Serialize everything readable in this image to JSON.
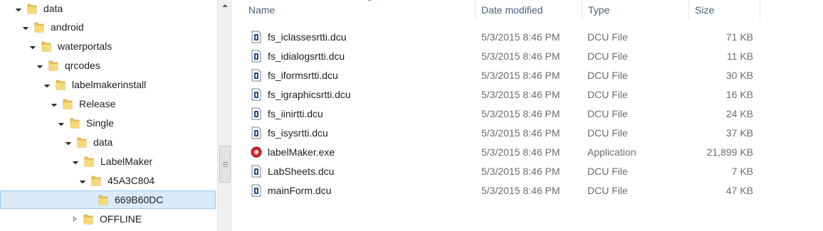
{
  "tree": {
    "items": [
      {
        "label": "data",
        "state": "expanded"
      },
      {
        "label": "android",
        "state": "expanded"
      },
      {
        "label": "waterportals",
        "state": "expanded"
      },
      {
        "label": "qrcodes",
        "state": "expanded"
      },
      {
        "label": "labelmakerinstall",
        "state": "expanded"
      },
      {
        "label": "Release",
        "state": "expanded"
      },
      {
        "label": "Single",
        "state": "expanded"
      },
      {
        "label": "data",
        "state": "expanded"
      },
      {
        "label": "LabelMaker",
        "state": "expanded"
      },
      {
        "label": "45A3C804",
        "state": "expanded"
      },
      {
        "label": "669B60DC",
        "state": "none",
        "selected": true
      },
      {
        "label": "OFFLINE",
        "state": "collapsed"
      }
    ]
  },
  "columns": {
    "name": "Name",
    "date": "Date modified",
    "type": "Type",
    "size": "Size"
  },
  "files": [
    {
      "name": "fs_iclassesrtti.dcu",
      "date": "5/3/2015 8:46 PM",
      "type": "DCU File",
      "size": "71 KB",
      "icon": "dcu-file-icon"
    },
    {
      "name": "fs_idialogsrtti.dcu",
      "date": "5/3/2015 8:46 PM",
      "type": "DCU File",
      "size": "11 KB",
      "icon": "dcu-file-icon"
    },
    {
      "name": "fs_iformsrtti.dcu",
      "date": "5/3/2015 8:46 PM",
      "type": "DCU File",
      "size": "30 KB",
      "icon": "dcu-file-icon"
    },
    {
      "name": "fs_igraphicsrtti.dcu",
      "date": "5/3/2015 8:46 PM",
      "type": "DCU File",
      "size": "16 KB",
      "icon": "dcu-file-icon"
    },
    {
      "name": "fs_iinirtti.dcu",
      "date": "5/3/2015 8:46 PM",
      "type": "DCU File",
      "size": "24 KB",
      "icon": "dcu-file-icon"
    },
    {
      "name": "fs_isysrtti.dcu",
      "date": "5/3/2015 8:46 PM",
      "type": "DCU File",
      "size": "37 KB",
      "icon": "dcu-file-icon"
    },
    {
      "name": "labelMaker.exe",
      "date": "5/3/2015 8:46 PM",
      "type": "Application",
      "size": "21,899 KB",
      "icon": "app-exe-icon"
    },
    {
      "name": "LabSheets.dcu",
      "date": "5/3/2015 8:46 PM",
      "type": "DCU File",
      "size": "7 KB",
      "icon": "dcu-file-icon"
    },
    {
      "name": "mainForm.dcu",
      "date": "5/3/2015 8:46 PM",
      "type": "DCU File",
      "size": "47 KB",
      "icon": "dcu-file-icon"
    }
  ],
  "colors": {
    "selection_bg": "#d9ebf9",
    "selection_border": "#99c9ef",
    "header_text": "#4c607a",
    "folder": "#e8c35a"
  }
}
